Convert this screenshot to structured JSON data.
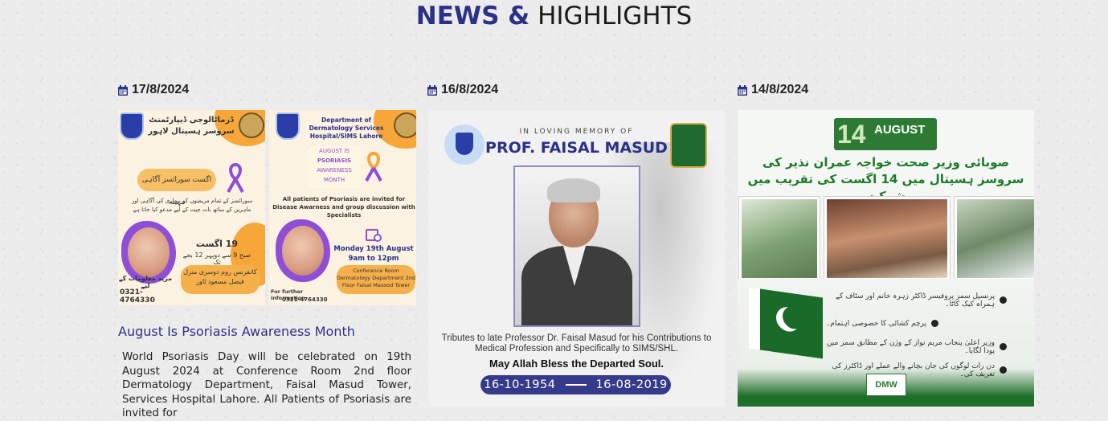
{
  "section": {
    "title_part1": "NEWS &",
    "title_part2": "HIGHLIGHTS"
  },
  "cards": [
    {
      "date": "17/8/2024",
      "heading": "August Is Psoriasis Awareness Month",
      "description": "World Psoriasis Day will be celebrated on 19th August 2024 at Conference Room 2nd floor Dermatology Department, Faisal Masud Tower, Services Hospital Lahore. All Patients of Psoriasis are invited for",
      "poster_left": {
        "title_urdu": "ڈرماٹالوجی ڈیپارٹمنٹ سروسز ہسپتال لاہور",
        "pill_urdu": "اگست سورائسز آگاہی مہینہ",
        "body_urdu": "سورائسز کے تمام مریضوں کو بیماری کی آگاہی اور ماہرین کے ساتھ بات چیت کے لیے مدعو کیا جاتا ہے",
        "date_urdu": "19 اگست",
        "time_urdu": "صبح 9 سے دوپہر 12 بجے تک",
        "venue_urdu": "کانفرنس روم دوسری منزل فیصل مسعود ٹاور",
        "info_urdu": "مزید معلومات کے لیے",
        "phone": "0321-4764330"
      },
      "poster_right": {
        "title": "Department of Dermatology Services Hospital/SIMS Lahore",
        "badge_line1": "AUGUST IS",
        "badge_line2": "PSORIASIS",
        "badge_line3": "AWARENESS",
        "badge_line4": "MONTH",
        "body": "All patients of Psoriasis are invited for Disease Awarness and group discussion with Specialists",
        "date": "Monday 19th August",
        "time": "9am to 12pm",
        "venue": "Conference Room Dermatology Department 2nd Floor Faisal Masood Tower",
        "info": "For further information",
        "phone": "0321-4764330"
      }
    },
    {
      "date": "16/8/2024",
      "memorial": {
        "line1": "IN LOVING MEMORY OF",
        "name": "PROF. FAISAL MASUD",
        "tribute": "Tributes to late Professor Dr. Faisal Masud for his Contributions to Medical Profession and Specifically to SIMS/SHL.",
        "bless": "May Allah Bless the Departed Soul.",
        "birth": "16-10-1954",
        "death": "16-08-2019"
      }
    },
    {
      "date": "14/8/2024",
      "independence": {
        "banner_number": "14",
        "banner_word": "AUGUST",
        "headline_urdu": "صوبائی وزیر صحت خواجہ عمران نذیر کی سروسز ہسپتال میں 14 اگست کی تقریب میں شرکت",
        "bullets": [
          "پرنسپل سمز پروفیسر ڈاکٹر زہرہ خانم اور سٹاف کے ہمراہ کیک کاٹا۔",
          "پرچم کشائی کا خصوصی اہتمام۔",
          "وزیر اعلیٰ پنجاب مریم نواز کے وژن کے مطابق سمز میں پودا لگایا۔",
          "دن رات لوگوں کی جان بچانے والے عملے اور ڈاکٹرز کی تعریف کی۔"
        ],
        "logo_text": "DMW"
      }
    }
  ]
}
